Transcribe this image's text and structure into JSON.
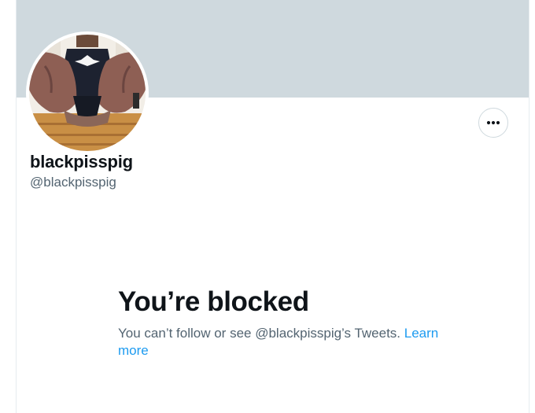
{
  "profile": {
    "display_name": "blackpisspig",
    "handle": "@blackpisspig",
    "banner_color": "#cfd9de",
    "avatar_icon": "profile-photo"
  },
  "actions": {
    "more_icon": "more-horizontal-icon"
  },
  "blocked": {
    "title": "You’re blocked",
    "message": "You can’t follow or see @blackpisspig’s Tweets.",
    "link_label": "Learn more"
  },
  "colors": {
    "primary_text": "#0f1419",
    "secondary_text": "#536471",
    "link": "#1d9bf0",
    "border": "#cfd9de"
  }
}
